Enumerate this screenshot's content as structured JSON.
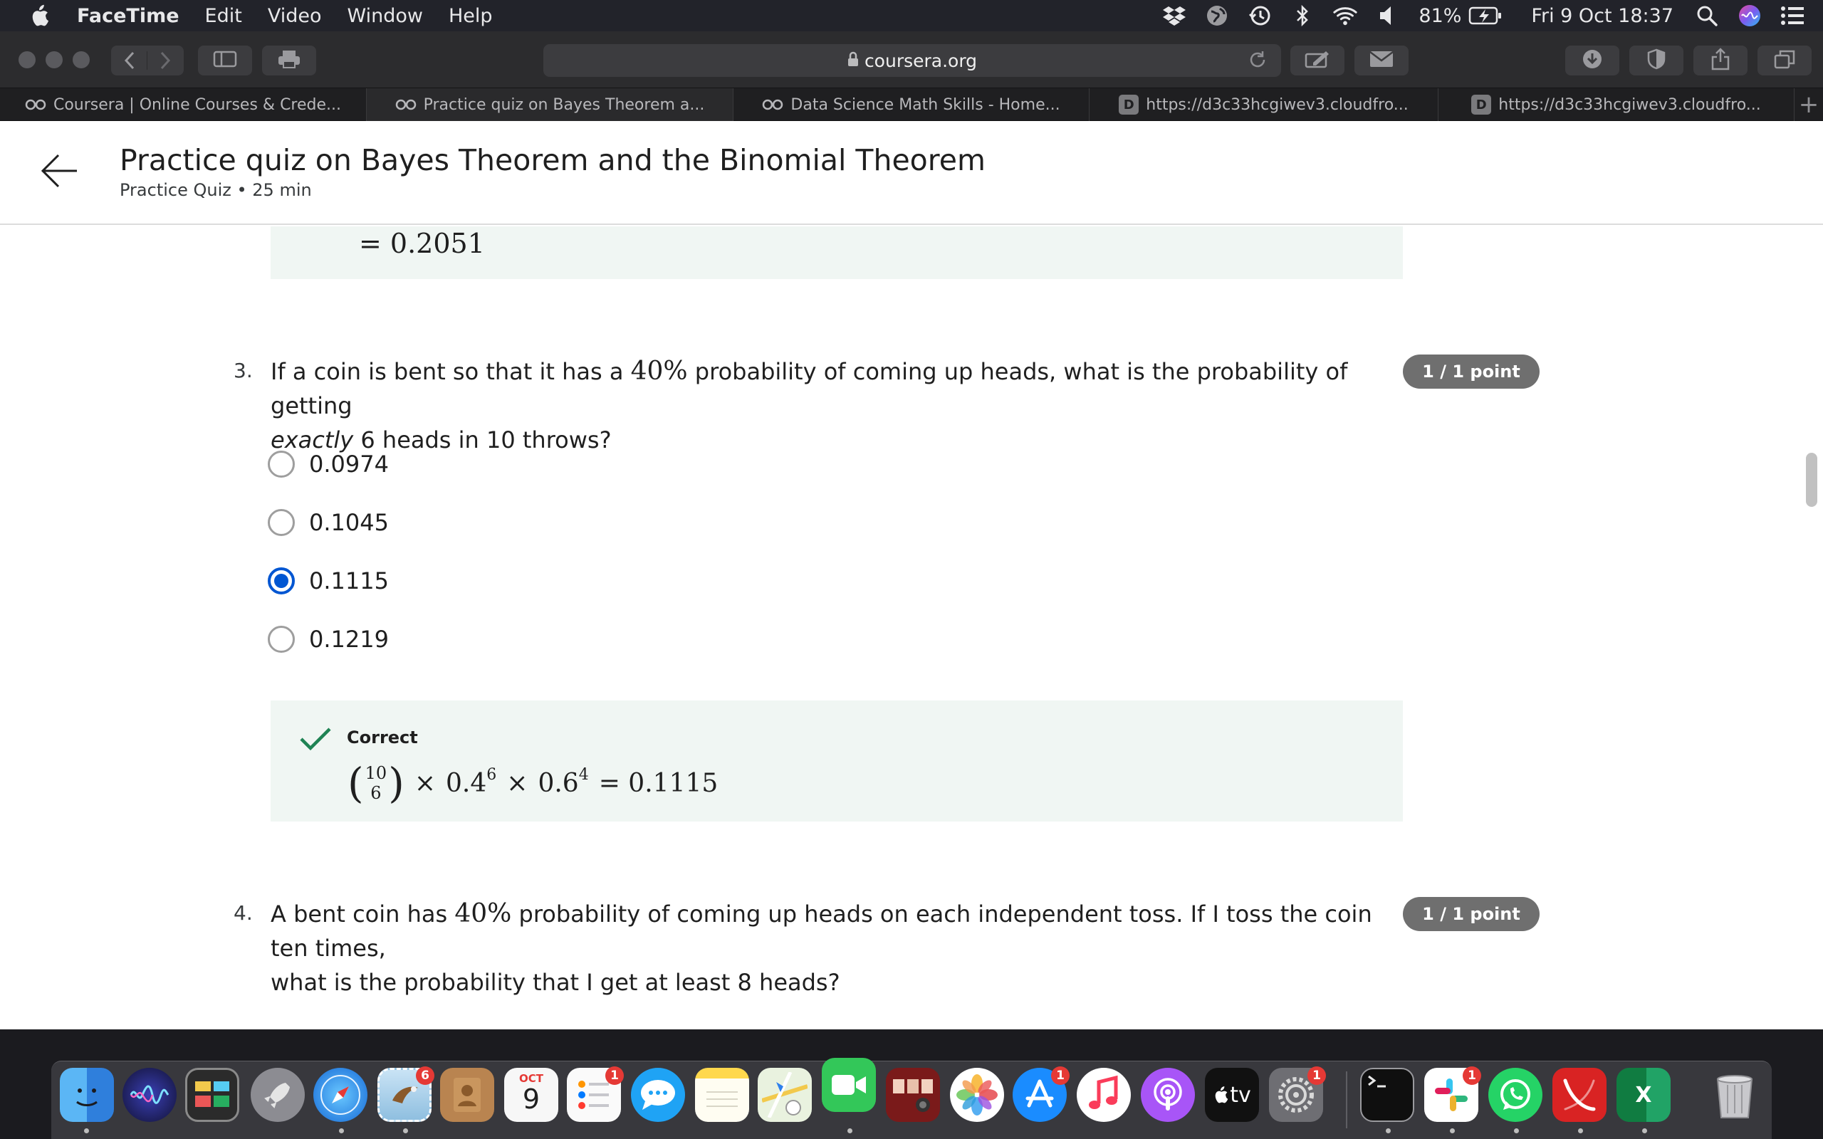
{
  "menubar": {
    "app_name": "FaceTime",
    "items": [
      "Edit",
      "Video",
      "Window",
      "Help"
    ],
    "battery": "81%",
    "datetime": "Fri 9 Oct  18:37"
  },
  "browser": {
    "url": "coursera.org",
    "tabs": [
      {
        "label": "Coursera | Online Courses & Crede...",
        "icon": "coursera-icon"
      },
      {
        "label": "Practice quiz on Bayes Theorem a...",
        "icon": "coursera-icon"
      },
      {
        "label": "Data Science Math Skills - Home...",
        "icon": "coursera-icon"
      },
      {
        "label": "https://d3c33hcgiwev3.cloudfro...",
        "icon": "D"
      },
      {
        "label": "https://d3c33hcgiwev3.cloudfro...",
        "icon": "D"
      }
    ]
  },
  "header": {
    "title": "Practice quiz on Bayes Theorem and the Binomial Theorem",
    "subtitle": "Practice Quiz • 25 min"
  },
  "prev_feedback": {
    "equation": "= 0.2051"
  },
  "q3": {
    "number": "3.",
    "text_part1": "If a coin is bent so that it has a ",
    "percent": "40%",
    "text_part2": " probability of coming up heads, what is the probability of getting",
    "text_em": "exactly",
    "text_part3": " 6 heads in 10 throws?",
    "points": "1 / 1 point",
    "options": [
      {
        "label": "0.0974",
        "selected": false
      },
      {
        "label": "0.1045",
        "selected": false
      },
      {
        "label": "0.1115",
        "selected": true
      },
      {
        "label": "0.1219",
        "selected": false
      }
    ],
    "feedback": {
      "status": "Correct",
      "binom_top": "10",
      "binom_bottom": "6",
      "times": "×",
      "base1": "0.4",
      "exp1": "6",
      "base2": "0.6",
      "exp2": "4",
      "result": "= 0.1115"
    }
  },
  "q4": {
    "number": "4.",
    "text_part1": "A bent coin has ",
    "percent": "40%",
    "text_part2": " probability of coming up heads on each independent toss. If I toss the coin ten times,",
    "text_line2": "what is the probability that I get at least 8 heads?",
    "points": "1 / 1 point"
  },
  "dock": {
    "badges": {
      "mail": "6",
      "reminders": "1",
      "appstore": "1",
      "sysprefs": "1",
      "slack": "1"
    },
    "calendar_month": "OCT",
    "calendar_day": "9",
    "tv_label": "tv"
  },
  "colors": {
    "accent": "#0056d2",
    "success": "#1f8354",
    "feedback_bg": "#f0f6f3",
    "points_badge": "#6f6f6f"
  }
}
